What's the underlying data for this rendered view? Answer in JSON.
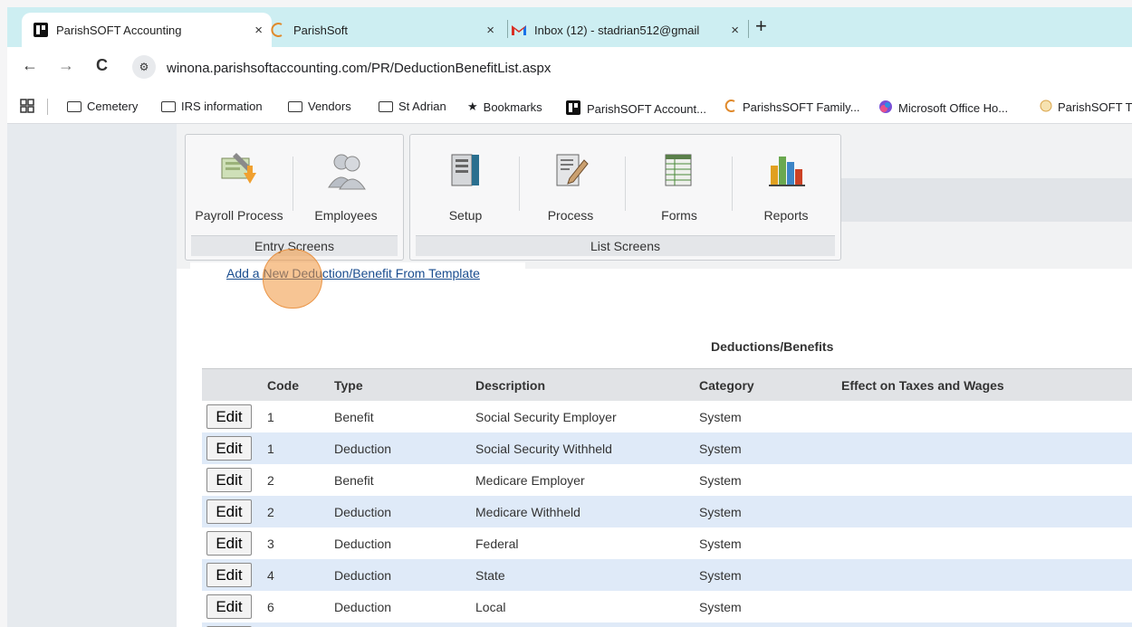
{
  "browser": {
    "tabs": [
      {
        "title": "ParishSOFT Accounting",
        "close": "×",
        "active": true
      },
      {
        "title": "ParishSoft",
        "close": "×",
        "active": false
      },
      {
        "title": "Inbox (12) - stadrian512@gmail",
        "close": "×",
        "active": false
      }
    ],
    "new_tab": "+",
    "nav": {
      "back": "←",
      "forward": "→",
      "reload": "C"
    },
    "site_badge": "⚙",
    "url": "winona.parishsoftaccounting.com/PR/DeductionBenefitList.aspx",
    "bookmarks": [
      {
        "label": "Cemetery",
        "icon": "folder-icon"
      },
      {
        "label": "IRS information",
        "icon": "folder-icon"
      },
      {
        "label": "Vendors",
        "icon": "folder-icon"
      },
      {
        "label": "St Adrian",
        "icon": "folder-icon"
      },
      {
        "label": "Bookmarks",
        "icon": "star-icon"
      },
      {
        "label": "ParishSOFT Account...",
        "icon": "parishsoft-logo-icon"
      },
      {
        "label": "ParishsSOFT Family...",
        "icon": "parishsoft-swirl-icon"
      },
      {
        "label": "Microsoft Office Ho...",
        "icon": "office-icon"
      },
      {
        "label": "ParishSOFT T",
        "icon": "parishsoft-circle-icon"
      }
    ]
  },
  "toolbar": {
    "entry_group": {
      "label": "Entry Screens",
      "items": [
        {
          "label": "Payroll Process",
          "icon": "payroll-process-icon"
        },
        {
          "label": "Employees",
          "icon": "employees-icon"
        }
      ]
    },
    "list_group": {
      "label": "List Screens",
      "items": [
        {
          "label": "Setup",
          "icon": "setup-icon"
        },
        {
          "label": "Process",
          "icon": "process-icon"
        },
        {
          "label": "Forms",
          "icon": "forms-icon"
        },
        {
          "label": "Reports",
          "icon": "reports-icon"
        }
      ]
    }
  },
  "page": {
    "add_link": "Add a New Deduction/Benefit From Template",
    "table_title": "Deductions/Benefits",
    "columns": [
      "",
      "Code",
      "Type",
      "Description",
      "Category",
      "Effect on Taxes and Wages"
    ],
    "edit_label": "Edit",
    "rows": [
      {
        "code": "1",
        "type": "Benefit",
        "description": "Social Security Employer",
        "category": "System",
        "effect": ""
      },
      {
        "code": "1",
        "type": "Deduction",
        "description": "Social Security Withheld",
        "category": "System",
        "effect": ""
      },
      {
        "code": "2",
        "type": "Benefit",
        "description": "Medicare Employer",
        "category": "System",
        "effect": ""
      },
      {
        "code": "2",
        "type": "Deduction",
        "description": "Medicare Withheld",
        "category": "System",
        "effect": ""
      },
      {
        "code": "3",
        "type": "Deduction",
        "description": "Federal",
        "category": "System",
        "effect": ""
      },
      {
        "code": "4",
        "type": "Deduction",
        "description": "State",
        "category": "System",
        "effect": ""
      },
      {
        "code": "6",
        "type": "Deduction",
        "description": "Local",
        "category": "System",
        "effect": ""
      }
    ]
  },
  "colors": {
    "tabstrip": "#cdeef2",
    "link": "#1a4d8f",
    "alt_row": "#dfeaf8",
    "cursor_highlight": "#f0963c"
  }
}
